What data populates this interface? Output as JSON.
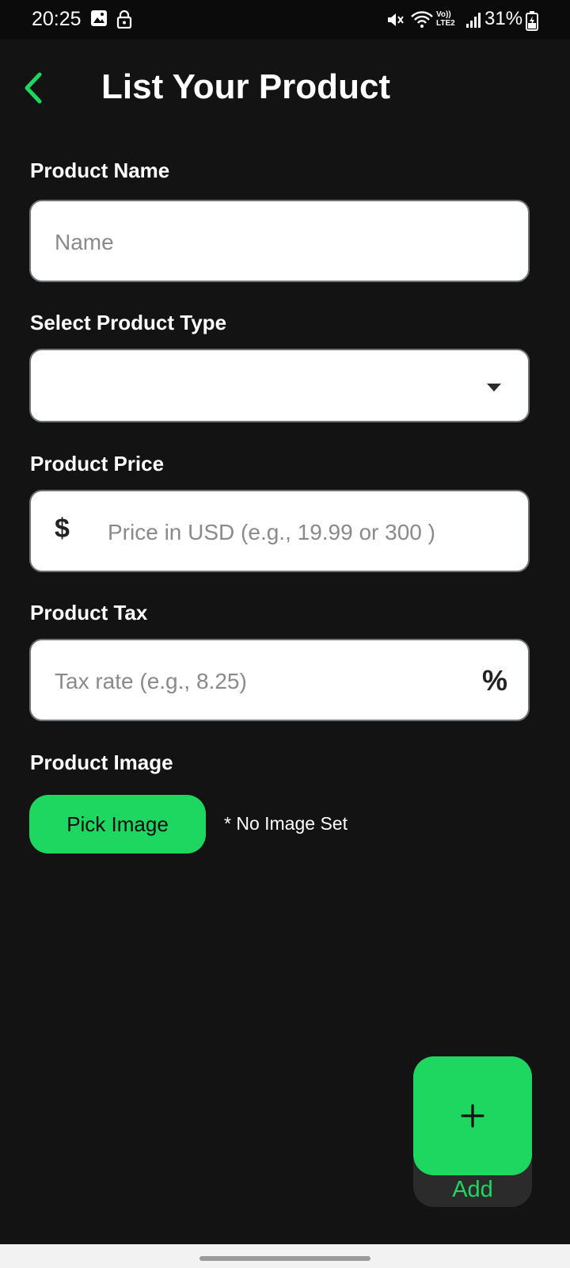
{
  "status_bar": {
    "time": "20:25",
    "network_label": "Vo)) LTE2",
    "battery": "31%",
    "icons": [
      "gallery-icon",
      "lock-icon",
      "mute-icon",
      "wifi-icon",
      "signal-icon",
      "battery-icon"
    ]
  },
  "header": {
    "title": "List Your Product",
    "back_icon": "chevron-left-icon"
  },
  "form": {
    "name": {
      "label": "Product Name",
      "value": "",
      "placeholder": "Name"
    },
    "type": {
      "label": "Select Product Type",
      "selected": ""
    },
    "price": {
      "label": "Product Price",
      "prefix": "$",
      "value": "",
      "placeholder": "Price in USD (e.g., 19.99 or 300 )"
    },
    "tax": {
      "label": "Product Tax",
      "suffix": "%",
      "value": "",
      "placeholder": "Tax rate (e.g., 8.25)"
    },
    "image": {
      "label": "Product Image",
      "button": "Pick Image",
      "status": "* No Image Set"
    }
  },
  "fab": {
    "icon": "plus-icon",
    "label": "Add"
  },
  "colors": {
    "accent": "#1ED760",
    "background": "#131314",
    "field_background": "#FFFFFF",
    "field_border": "#6D747A"
  }
}
